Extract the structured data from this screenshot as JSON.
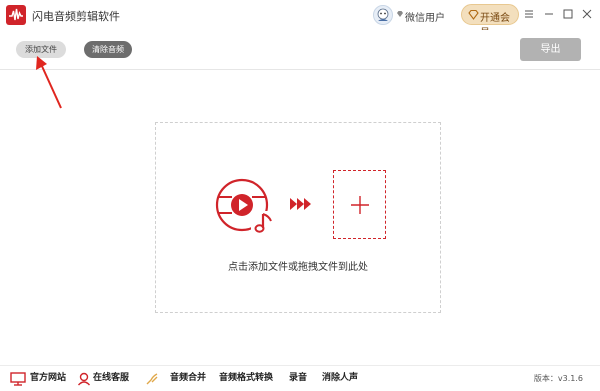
{
  "app": {
    "title": "闪电音频剪辑软件",
    "brand_color": "#d0242a"
  },
  "user": {
    "name": "微信用户"
  },
  "header": {
    "vip_label": "开通会员"
  },
  "toolbar": {
    "add_file_label": "添加文件",
    "clear_audio_label": "清除音频",
    "export_label": "导出"
  },
  "dropzone": {
    "hint": "点击添加文件或拖拽文件到此处"
  },
  "bottom": {
    "items": [
      {
        "label": "官方网站",
        "icon": "monitor-icon"
      },
      {
        "label": "在线客服",
        "icon": "headset-icon"
      },
      {
        "label": "音频合并",
        "icon": "merge-icon"
      },
      {
        "label": "音频格式转换",
        "icon": ""
      },
      {
        "label": "录音",
        "icon": ""
      },
      {
        "label": "消除人声",
        "icon": ""
      }
    ],
    "version": "版本：v3.1.6"
  }
}
